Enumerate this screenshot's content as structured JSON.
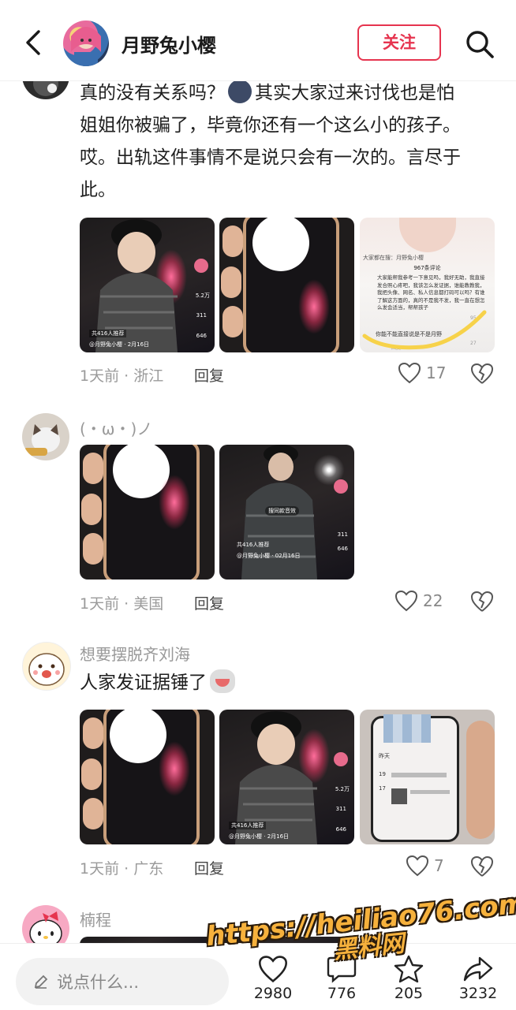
{
  "header": {
    "title": "月野兔小樱",
    "follow_label": "关注"
  },
  "comments": [
    {
      "text_lines": [
        "真的没有关系吗？",
        "其实大家过来讨伐也是怕",
        "姐姐你被骗了，毕竟你还有一个这么小的孩子。",
        "哎。出轨这件事情不是说只会有一次的。言尽于",
        "此。"
      ],
      "meta": "1天前 · 浙江",
      "reply_label": "回复",
      "likes": "17",
      "thumbs": [
        {
          "caption_user": "@月野兔小樱",
          "date": "2月16日",
          "recommend": "共416人推荐",
          "like_count": "5.2万",
          "comment_count": "311",
          "star_count": "646"
        },
        {},
        {
          "tab": "大家都在搜：月野兔小樱",
          "heading": "967条评论",
          "body": "大家能帮我参考一下意见吗，我好无助，我直接发合照心疼吧，我该怎么发证据，谁能教教我，我把头像、网名、私人信息都打码可以吗？有谁了解这方面的，真的不是我不发，我一直在想怎么发会适当，帮帮孩子",
          "reply_text": "你能不能直接说是不是月野",
          "reply_label": "回复",
          "count_a": "95",
          "count_b": "27"
        }
      ]
    },
    {
      "username": "(・ω・)ノ",
      "meta": "1天前 · 美国",
      "reply_label": "回复",
      "likes": "22",
      "thumbs": [
        {},
        {
          "caption_user": "@月野兔小樱",
          "date": "02月16日",
          "recommend": "共416人推荐",
          "like_count": "5.2万",
          "comment_count": "311",
          "star_count": "646",
          "search_label": "搜同款音效"
        }
      ]
    },
    {
      "username": "想要摆脱齐刘海",
      "text": "人家发证据锤了",
      "meta": "1天前 · 广东",
      "reply_label": "回复",
      "likes": "7",
      "thumbs": [
        {},
        {
          "caption_user": "@月野兔小樱",
          "date": "2月16日",
          "recommend": "共416人推荐",
          "like_count": "5.2万",
          "comment_count": "311",
          "star_count": "646"
        },
        {
          "day_a": "昨天",
          "day_b": "19",
          "day_c": "17"
        }
      ]
    },
    {
      "username": "楠程"
    }
  ],
  "bottom_bar": {
    "input_placeholder": "说点什么...",
    "like_count": "2980",
    "comment_count": "776",
    "star_count": "205",
    "share_count": "3232"
  },
  "watermark": {
    "url": "https://heiliao76.com",
    "site": "黑料网"
  },
  "colors": {
    "accent": "#e6344f",
    "meta_text": "#9a9a9a",
    "watermark": "#f6b13c"
  }
}
